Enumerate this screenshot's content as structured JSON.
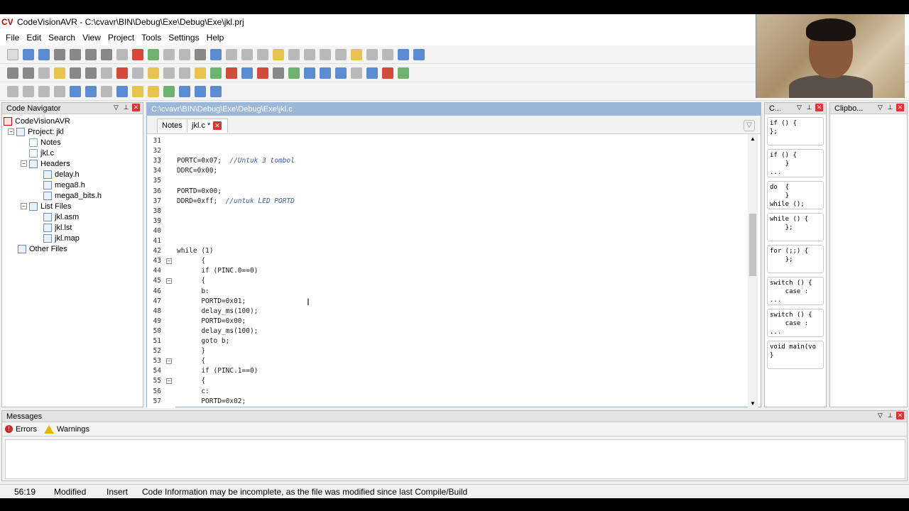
{
  "window": {
    "title": "CodeVisionAVR - C:\\cvavr\\BIN\\Debug\\Exe\\Debug\\Exe\\jkl.prj",
    "logo": "CV"
  },
  "menu": [
    "File",
    "Edit",
    "Search",
    "View",
    "Project",
    "Tools",
    "Settings",
    "Help"
  ],
  "navigator": {
    "title": "Code Navigator",
    "root": "CodeVisionAVR",
    "project": "Project: jkl",
    "items": [
      {
        "label": "Notes"
      },
      {
        "label": "jkl.c"
      },
      {
        "label": "Headers"
      },
      {
        "label": "delay.h"
      },
      {
        "label": "mega8.h"
      },
      {
        "label": "mega8_bits.h"
      },
      {
        "label": "List Files"
      },
      {
        "label": "jkl.asm"
      },
      {
        "label": "jkl.lst"
      },
      {
        "label": "jkl.map"
      },
      {
        "label": "Other Files"
      }
    ]
  },
  "editor": {
    "path": "C:\\cvavr\\BIN\\Debug\\Exe\\Debug\\Exe\\jkl.c",
    "tabs": [
      "Notes",
      "jkl.c *"
    ],
    "lines": [
      {
        "n": "31",
        "t": ""
      },
      {
        "n": "32",
        "t": ""
      },
      {
        "n": "33",
        "t": "PORTC=0x07;  ",
        "c": "//Untuk 3 tombol"
      },
      {
        "n": "34",
        "t": "DDRC=0x00;"
      },
      {
        "n": "35",
        "t": ""
      },
      {
        "n": "36",
        "t": "PORTD=0x00;"
      },
      {
        "n": "37",
        "t": "DDRD=0xff;  ",
        "c": "//untuk LED PORTD"
      },
      {
        "n": "38",
        "t": ""
      },
      {
        "n": "39",
        "t": ""
      },
      {
        "n": "40",
        "t": ""
      },
      {
        "n": "41",
        "t": ""
      },
      {
        "n": "42",
        "t": "while (1)"
      },
      {
        "n": "43",
        "t": "      {"
      },
      {
        "n": "44",
        "t": "      if (PINC.0==0)"
      },
      {
        "n": "45",
        "t": "      {"
      },
      {
        "n": "46",
        "t": "      b:"
      },
      {
        "n": "47",
        "t": "      PORTD=0x01;"
      },
      {
        "n": "48",
        "t": "      delay_ms(100);"
      },
      {
        "n": "49",
        "t": "      PORTD=0x00;"
      },
      {
        "n": "50",
        "t": "      delay_ms(100);"
      },
      {
        "n": "51",
        "t": "      goto b;"
      },
      {
        "n": "52",
        "t": "      }"
      },
      {
        "n": "53",
        "t": "      {"
      },
      {
        "n": "54",
        "t": "      if (PINC.1==0)"
      },
      {
        "n": "55",
        "t": "      {"
      },
      {
        "n": "56",
        "t": "      c:"
      },
      {
        "n": "57",
        "t": "      PORTD=0x02;"
      }
    ]
  },
  "snippets": {
    "title": "C...",
    "items": [
      "if () {\n};",
      "if () {\n    }\n...",
      "do  {\n    }\nwhile ();",
      "while () {\n    };",
      "for (;;) {\n    };",
      "switch () {\n    case :\n...",
      "switch () {\n    case :\n...",
      "void main(vo\n}"
    ]
  },
  "clipboard": {
    "title": "Clipbo..."
  },
  "messages": {
    "title": "Messages",
    "tabs": [
      "Errors",
      "Warnings"
    ]
  },
  "status": {
    "position": "56:19",
    "modified": "Modified",
    "mode": "Insert",
    "info": "Code Information may be incomplete, as the file was modified since last Compile/Build"
  }
}
